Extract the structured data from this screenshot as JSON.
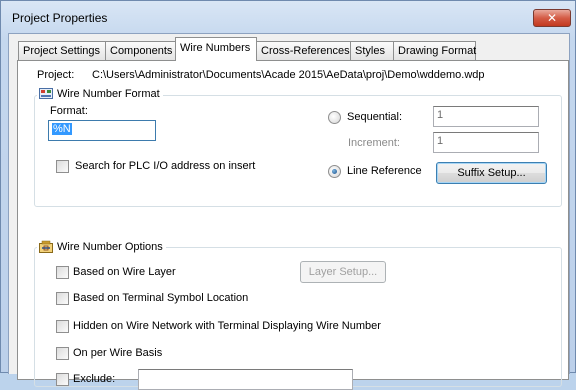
{
  "window": {
    "title": "Project Properties",
    "close_glyph": "✕"
  },
  "tabs": [
    {
      "label": "Project Settings"
    },
    {
      "label": "Components"
    },
    {
      "label": "Wire Numbers"
    },
    {
      "label": "Cross-References"
    },
    {
      "label": "Styles"
    },
    {
      "label": "Drawing Format"
    }
  ],
  "active_tab": "Wire Numbers",
  "project": {
    "label": "Project:",
    "path": "C:\\Users\\Administrator\\Documents\\Acade 2015\\AeData\\proj\\Demo\\wddemo.wdp"
  },
  "wire_number_format": {
    "title": "Wire Number Format",
    "icon": "wire-number-format-icon",
    "format_label": "Format:",
    "format_value": "%N",
    "plc_search_label": "Search for PLC I/O address on insert",
    "plc_search_checked": false,
    "sequential_label": "Sequential:",
    "sequential_value": "1",
    "increment_label": "Increment:",
    "increment_value": "1",
    "line_reference_label": "Line Reference",
    "selected_mode": "Line Reference",
    "suffix_button": "Suffix Setup..."
  },
  "wire_number_options": {
    "title": "Wire Number Options",
    "icon": "wire-number-options-icon",
    "based_on_wire_layer": "Based on Wire Layer",
    "layer_setup_button": "Layer Setup...",
    "based_on_terminal": "Based on Terminal Symbol Location",
    "hidden_on_network": "Hidden on Wire Network with Terminal Displaying Wire Number",
    "per_wire_basis": "On per Wire Basis",
    "exclude_label": "Exclude:",
    "exclude_value": ""
  },
  "colors": {
    "accent": "#3399ff",
    "close_button": "#c2391f",
    "titlebar": "#c4d7ee"
  }
}
